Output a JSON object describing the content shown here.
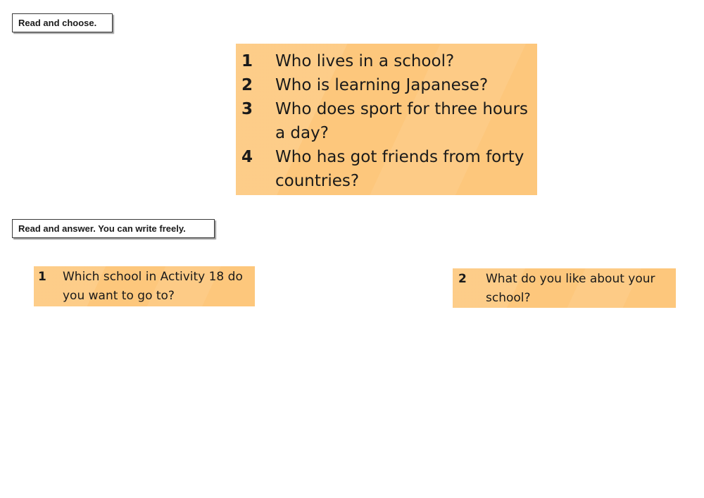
{
  "section1": {
    "instruction": "Read and choose.",
    "questions": [
      {
        "num": "1",
        "text": "Who lives in a school?"
      },
      {
        "num": "2",
        "text": "Who is learning Japanese?"
      },
      {
        "num": "3",
        "text": "Who does sport for three hours a day?"
      },
      {
        "num": "4",
        "text": "Who has got friends from forty countries?"
      }
    ]
  },
  "section2": {
    "instruction": "Read and answer. You can write freely.",
    "questions": [
      {
        "num": "1",
        "text": "Which school in Activity 18 do you want to go to?"
      },
      {
        "num": "2",
        "text": "What do you like about your school?"
      }
    ]
  },
  "colors": {
    "card_background": "#fdc77c",
    "instruction_border": "#3a3a3a"
  }
}
